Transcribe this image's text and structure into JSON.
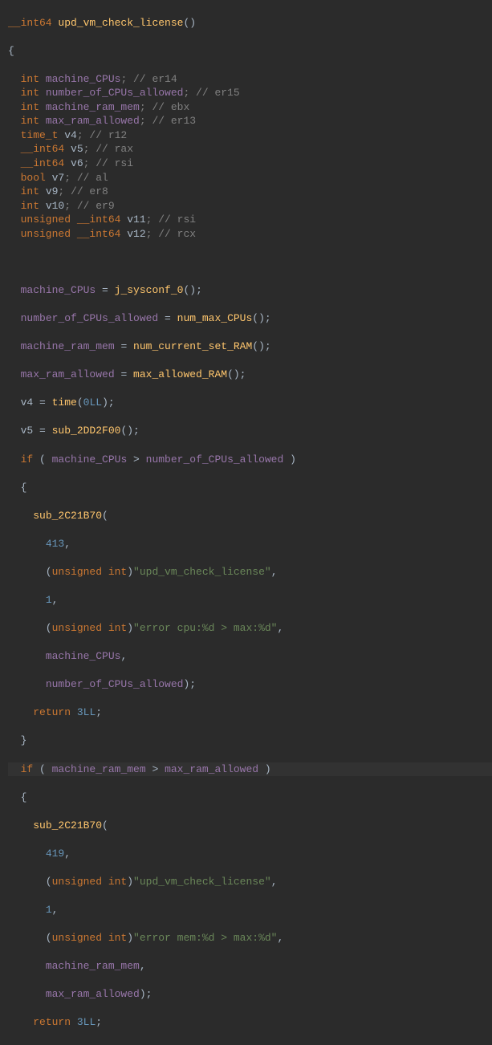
{
  "code": {
    "func_signature_type": "__int64 ",
    "func_name": "upd_vm_check_license",
    "decl_lines": [
      {
        "indent": "  ",
        "type": "int ",
        "name": "machine_CPUs",
        "comment": "; // er14",
        "renamed": true
      },
      {
        "indent": "  ",
        "type": "int ",
        "name": "number_of_CPUs_allowed",
        "comment": "; // er15",
        "renamed": true
      },
      {
        "indent": "  ",
        "type": "int ",
        "name": "machine_ram_mem",
        "comment": "; // ebx",
        "renamed": true
      },
      {
        "indent": "  ",
        "type": "int ",
        "name": "max_ram_allowed",
        "comment": "; // er13",
        "renamed": true
      },
      {
        "indent": "  ",
        "type": "time_t ",
        "name": "v4",
        "comment": "; // r12",
        "renamed": false
      },
      {
        "indent": "  ",
        "type": "__int64 ",
        "name": "v5",
        "comment": "; // rax",
        "renamed": false
      },
      {
        "indent": "  ",
        "type": "__int64 ",
        "name": "v6",
        "comment": "; // rsi",
        "renamed": false
      },
      {
        "indent": "  ",
        "type": "bool ",
        "name": "v7",
        "comment": "; // al",
        "renamed": false
      },
      {
        "indent": "  ",
        "type": "int ",
        "name": "v9",
        "comment": "; // er8",
        "renamed": false
      },
      {
        "indent": "  ",
        "type": "int ",
        "name": "v10",
        "comment": "; // er9",
        "renamed": false
      },
      {
        "indent": "  ",
        "type": "unsigned __int64 ",
        "name": "v11",
        "comment": "; // rsi",
        "renamed": false
      },
      {
        "indent": "  ",
        "type": "unsigned __int64 ",
        "name": "v12",
        "comment": "; // rcx",
        "renamed": false
      }
    ],
    "assign1": {
      "var": "machine_CPUs",
      "call": "j_sysconf_0"
    },
    "assign2": {
      "var": "number_of_CPUs_allowed",
      "call": "num_max_CPUs"
    },
    "assign3": {
      "var": "machine_ram_mem",
      "call": "num_current_set_RAM"
    },
    "assign4": {
      "var": "max_ram_allowed",
      "call": "max_allowed_RAM"
    },
    "assign5": {
      "var": "v4",
      "call": "time",
      "arg": "0LL"
    },
    "assign6": {
      "var": "v5",
      "call": "sub_2DD2F00"
    },
    "if1": {
      "kw": "if",
      "lhs": "machine_CPUs",
      "op": " > ",
      "rhs": "number_of_CPUs_allowed"
    },
    "sub_name": "sub_2C21B70",
    "call1_args": {
      "line_no": "413",
      "cast": "unsigned int",
      "str1": "\"upd_vm_check_license\"",
      "num2": "1",
      "str2": "\"error cpu:%d > max:%d\"",
      "arg_a": "machine_CPUs",
      "arg_b": "number_of_CPUs_allowed"
    },
    "return_val": "3LL",
    "if2": {
      "kw": "if",
      "lhs": "machine_ram_mem",
      "op": " > ",
      "rhs": "max_ram_allowed"
    },
    "call2_args": {
      "line_no": "419",
      "str1": "\"upd_vm_check_license\"",
      "num2": "1",
      "str2": "\"error mem:%d > max:%d\"",
      "arg_a": "machine_ram_mem",
      "arg_b": "max_ram_allowed"
    }
  }
}
